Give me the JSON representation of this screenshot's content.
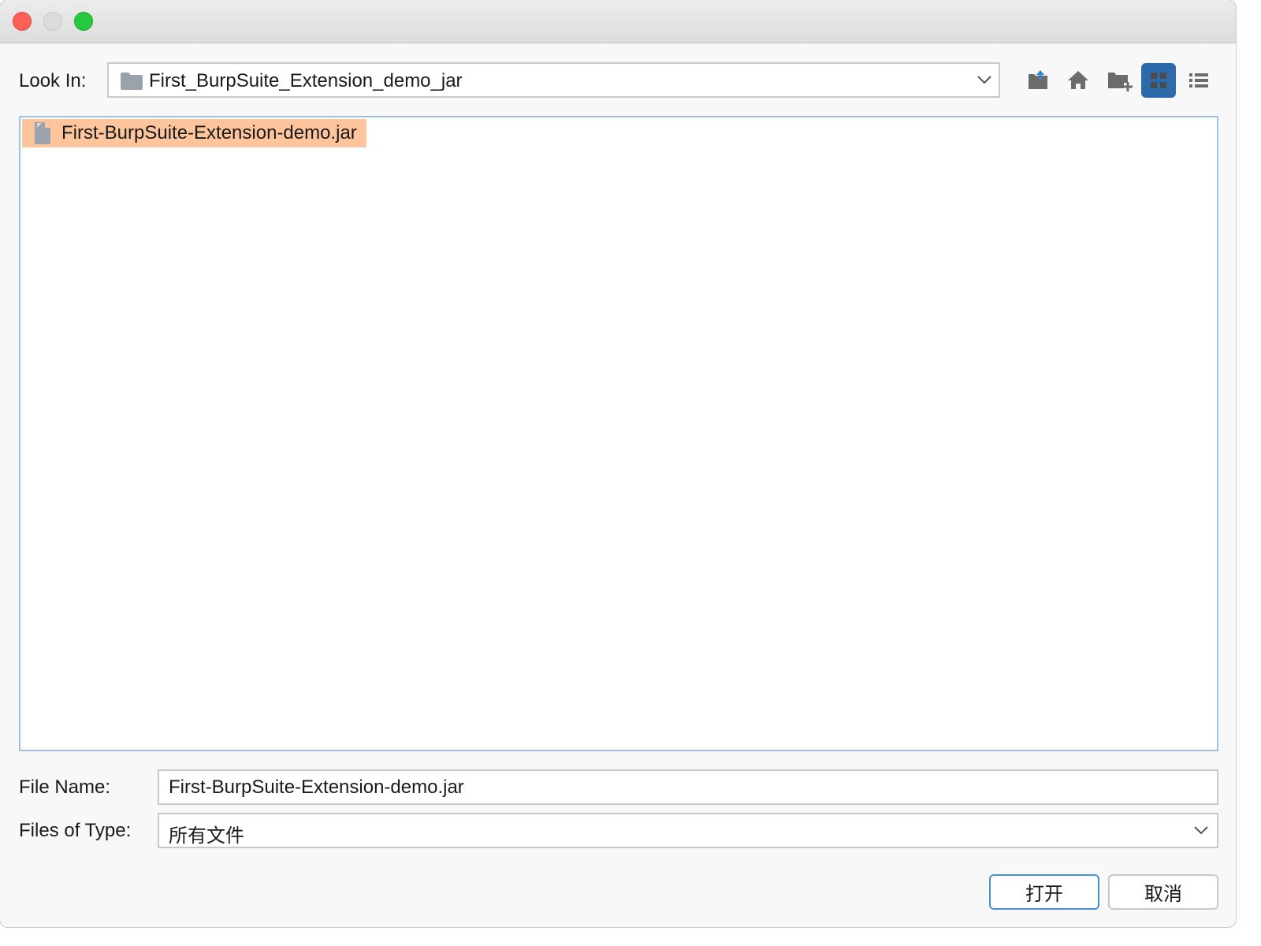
{
  "window": {
    "controls": [
      "close",
      "minimize",
      "maximize"
    ]
  },
  "look_in": {
    "label": "Look In:",
    "value": "First_BurpSuite_Extension_demo_jar",
    "icon": "folder-icon"
  },
  "toolbar": {
    "buttons": [
      {
        "name": "up-folder-icon",
        "active": false
      },
      {
        "name": "home-icon",
        "active": false
      },
      {
        "name": "new-folder-icon",
        "active": false
      },
      {
        "name": "list-view-icon",
        "active": true
      },
      {
        "name": "details-view-icon",
        "active": false
      }
    ]
  },
  "file_list": {
    "items": [
      {
        "name": "First-BurpSuite-Extension-demo.jar",
        "icon": "file-icon",
        "selected": true
      }
    ]
  },
  "file_name": {
    "label": "File Name:",
    "value": "First-BurpSuite-Extension-demo.jar"
  },
  "files_of_type": {
    "label": "Files of Type:",
    "value": "所有文件"
  },
  "buttons": {
    "open": "打开",
    "cancel": "取消"
  },
  "colors": {
    "selection": "#fec59d",
    "active_toggle": "#2d6aa9",
    "focus_border": "#4a90d9"
  }
}
